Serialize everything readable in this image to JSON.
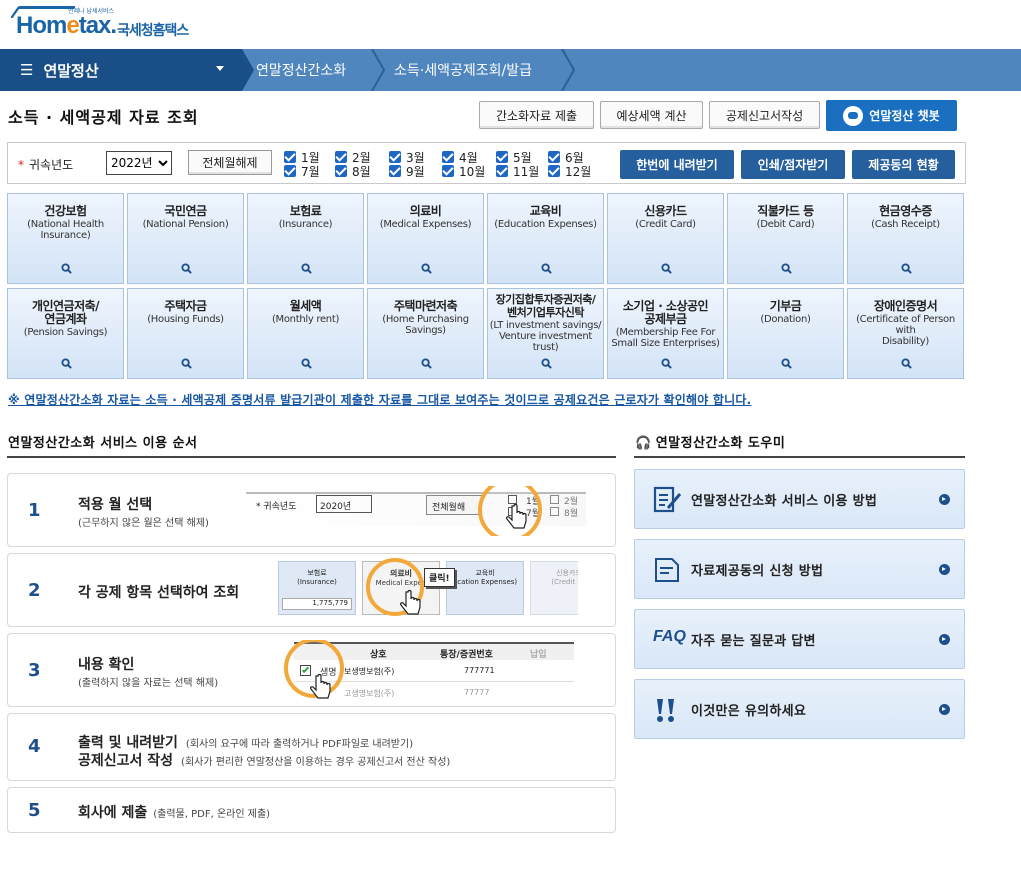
{
  "logo": {
    "name": "Hometax",
    "brand_suffix": "국세청홈택스",
    "tagline": "언제나 납세서비스"
  },
  "nav": {
    "main": "연말정산",
    "crumbs": [
      "연말정산간소화",
      "소득·세액공제조회/발급"
    ]
  },
  "page_title": "소득 · 세액공제 자료 조회",
  "top_buttons": [
    "간소화자료 제출",
    "예상세액 계산",
    "공제신고서작성",
    "연말정산 챗봇"
  ],
  "filter": {
    "label": "귀속년도",
    "year": "2022년",
    "clear_label": "전체월해제",
    "months_row1": [
      "1월",
      "2월",
      "3월",
      "4월",
      "5월",
      "6월"
    ],
    "months_row2": [
      "7월",
      "8월",
      "9월",
      "10월",
      "11월",
      "12월"
    ],
    "action_buttons": [
      "한번에 내려받기",
      "인쇄/점자받기",
      "제공동의 현황"
    ]
  },
  "categories": [
    {
      "title": "건강보험",
      "eng": "(National Health\nInsurance)"
    },
    {
      "title": "국민연금",
      "eng": "(National Pension)"
    },
    {
      "title": "보험료",
      "eng": "(Insurance)"
    },
    {
      "title": "의료비",
      "eng": "(Medical Expenses)"
    },
    {
      "title": "교육비",
      "eng": "(Education Expenses)"
    },
    {
      "title": "신용카드",
      "eng": "(Credit Card)"
    },
    {
      "title": "직불카드 등",
      "eng": "(Debit Card)"
    },
    {
      "title": "현금영수증",
      "eng": "(Cash Receipt)"
    },
    {
      "title": "개인연금저축/\n연금계좌",
      "eng": "(Pension Savings)"
    },
    {
      "title": "주택자금",
      "eng": "(Housing Funds)"
    },
    {
      "title": "월세액",
      "eng": "(Monthly rent)"
    },
    {
      "title": "주택마련저축",
      "eng": "(Home Purchasing\nSavings)"
    },
    {
      "title": "장기집합투자증권저축/\n벤처기업투자신탁",
      "eng": "(LT investment savings/\nVenture investment\ntrust)"
    },
    {
      "title": "소기업 · 소상공인\n공제부금",
      "eng": "(Membership Fee For\nSmall Size Enterprises)"
    },
    {
      "title": "기부금",
      "eng": "(Donation)"
    },
    {
      "title": "장애인증명서",
      "eng": "(Certificate of Person with\nDisability)"
    }
  ],
  "notice": "※ 연말정산간소화 자료는 소득 · 세액공제 증명서류 발급기관이 제출한 자료를 그대로 보여주는 것이므로 공제요건은 근로자가 확인해야 합니다.",
  "steps_title": "연말정산간소화 서비스 이용 순서",
  "steps": [
    {
      "num": "1",
      "title": "적용 월 선택",
      "sub": "(근무하지 않은 월은 선택 해제)"
    },
    {
      "num": "2",
      "title": "각 공제 항목 선택하여 조회",
      "sub": ""
    },
    {
      "num": "3",
      "title": "내용 확인",
      "sub": "(출력하지 않을 자료는 선택 해제)"
    },
    {
      "num": "4",
      "title": "출력 및 내려받기",
      "sub": "(회사의 요구에 따라 출력하거나 PDF파일로 내려받기)",
      "title2": "공제신고서 작성",
      "sub2": "(회사가 편리한 연말정산을 이용하는 경우 공제신고서 전산 작성)"
    },
    {
      "num": "5",
      "title": "회사에 제출",
      "sub": "(출력물, PDF, 온라인 제출)"
    }
  ],
  "illustrations": {
    "s1": {
      "label": "귀속년도",
      "year": "2020년",
      "clear": "전체월해",
      "m1": "1월",
      "m2": "2월",
      "m7": "7월",
      "m8": "8월"
    },
    "s2": {
      "c1": "보험료",
      "c1e": "(Insurance)",
      "c1v": "1,775,779",
      "c2": "의료비",
      "c2e": "Medical Expen",
      "c3": "교육비",
      "c3e": "ucation Expenses)",
      "c4": "신용카드",
      "c4e": "(Credit Ca",
      "click": "클릭!"
    },
    "s3": {
      "h1": "상호",
      "h2": "통장/증권번호",
      "h3": "납입",
      "r1a": "생명",
      "r1b": "보생명보험(주)",
      "r1c": "777771",
      "r2a": "고생명보험(주)",
      "r2c": "77777"
    }
  },
  "helper_title": "연말정산간소화 도우미",
  "helpers": [
    {
      "label": "연말정산간소화 서비스 이용 방법",
      "icon": "document-pen-icon"
    },
    {
      "label": "자료제공동의 신청 방법",
      "icon": "document-icon"
    },
    {
      "label": "자주 묻는 질문과 답변",
      "icon": "faq-icon",
      "badge": "FAQ"
    },
    {
      "label": "이것만은 유의하세요",
      "icon": "exclamation-icon"
    }
  ],
  "colors": {
    "primary_dark": "#1a4e86",
    "nav": "#4f86bd",
    "accent": "#f3a83c",
    "button": "#265f9e"
  }
}
